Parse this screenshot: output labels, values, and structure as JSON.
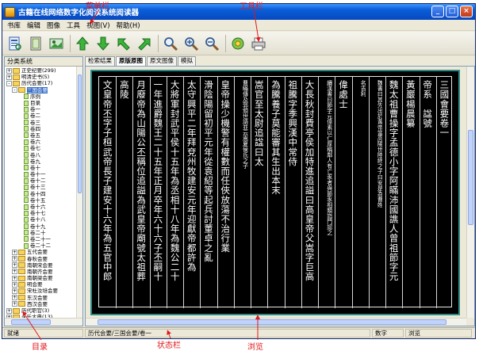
{
  "window": {
    "title": "古籍在线网络数字化阅读系统阅读器",
    "btn_min": "_",
    "btn_max": "□",
    "btn_close": "×"
  },
  "menu": [
    "书库",
    "编辑",
    "图像",
    "工具",
    "视图(V)",
    "帮助(H)"
  ],
  "toolbar": {
    "buttons": [
      "open-book-icon",
      "page-icon",
      "image-icon",
      "arrow-up-icon",
      "arrow-down-icon",
      "arrow-back-icon",
      "arrow-forward-icon",
      "search-icon",
      "zoom-in-icon",
      "zoom-out-icon",
      "globe-icon",
      "print-icon"
    ]
  },
  "left_panel": {
    "title": "分类系统",
    "tree": [
      {
        "label": "正史纪要(299)",
        "level": 0,
        "exp": "+",
        "type": "folder"
      },
      {
        "label": "明清史书(5)",
        "level": 0,
        "exp": "+",
        "type": "folder"
      },
      {
        "label": "历代会要(17)",
        "level": 0,
        "exp": "-",
        "type": "folder"
      },
      {
        "label": "三国会要",
        "level": 1,
        "exp": "-",
        "type": "folder",
        "selected": true
      },
      {
        "label": "序例",
        "level": 2,
        "type": "doc"
      },
      {
        "label": "目录",
        "level": 2,
        "type": "doc"
      },
      {
        "label": "卷一",
        "level": 2,
        "type": "doc"
      },
      {
        "label": "卷二",
        "level": 2,
        "type": "doc"
      },
      {
        "label": "卷三",
        "level": 2,
        "type": "doc"
      },
      {
        "label": "卷四",
        "level": 2,
        "type": "doc"
      },
      {
        "label": "卷五",
        "level": 2,
        "type": "doc"
      },
      {
        "label": "卷六",
        "level": 2,
        "type": "doc"
      },
      {
        "label": "卷七",
        "level": 2,
        "type": "doc"
      },
      {
        "label": "卷八",
        "level": 2,
        "type": "doc"
      },
      {
        "label": "卷九",
        "level": 2,
        "type": "doc"
      },
      {
        "label": "卷十",
        "level": 2,
        "type": "doc"
      },
      {
        "label": "卷十一",
        "level": 2,
        "type": "doc"
      },
      {
        "label": "卷十二",
        "level": 2,
        "type": "doc"
      },
      {
        "label": "卷十三",
        "level": 2,
        "type": "doc"
      },
      {
        "label": "卷十四",
        "level": 2,
        "type": "doc"
      },
      {
        "label": "卷十五",
        "level": 2,
        "type": "doc"
      },
      {
        "label": "卷十六",
        "level": 2,
        "type": "doc"
      },
      {
        "label": "卷十七",
        "level": 2,
        "type": "doc"
      },
      {
        "label": "卷十八",
        "level": 2,
        "type": "doc"
      },
      {
        "label": "卷十九",
        "level": 2,
        "type": "doc"
      },
      {
        "label": "卷二十",
        "level": 2,
        "type": "doc"
      },
      {
        "label": "卷二十一",
        "level": 2,
        "type": "doc"
      },
      {
        "label": "卷二十二",
        "level": 2,
        "type": "doc"
      },
      {
        "label": "五代会要",
        "level": 1,
        "exp": "+",
        "type": "folder"
      },
      {
        "label": "春秋会要",
        "level": 1,
        "exp": "+",
        "type": "folder"
      },
      {
        "label": "南朝宋会要",
        "level": 1,
        "exp": "+",
        "type": "folder"
      },
      {
        "label": "南朝齐会要",
        "level": 1,
        "exp": "+",
        "type": "folder"
      },
      {
        "label": "南朝梁会要",
        "level": 1,
        "exp": "+",
        "type": "folder"
      },
      {
        "label": "明会要",
        "level": 1,
        "exp": "+",
        "type": "folder"
      },
      {
        "label": "宋杜汝培会要",
        "level": 1,
        "exp": "+",
        "type": "folder"
      },
      {
        "label": "东汉会要",
        "level": 1,
        "exp": "+",
        "type": "folder"
      },
      {
        "label": "西汉会要",
        "level": 1,
        "exp": "+",
        "type": "folder"
      },
      {
        "label": "历代职官(3)",
        "level": 0,
        "exp": "+",
        "type": "folder"
      },
      {
        "label": "永乐大典(13)",
        "level": 0,
        "exp": "+",
        "type": "folder"
      },
      {
        "label": "书目",
        "level": 0,
        "exp": "+",
        "type": "folder"
      },
      {
        "label": "经史子集",
        "level": 0,
        "exp": "+",
        "type": "folder"
      },
      {
        "label": "四库存目",
        "level": 0,
        "exp": "+",
        "type": "folder"
      }
    ]
  },
  "tabs": [
    "检索结果",
    "原版原图",
    "原文图像",
    "模拟"
  ],
  "book": {
    "columns": [
      {
        "text": "三國會要卷一",
        "size": "big"
      },
      {
        "text": "帝系　諡號",
        "size": "big"
      },
      {
        "text": "黃巖楊晨纂",
        "size": "big"
      },
      {
        "text": "魏太祖曹操字孟德小字阿瞞沛國譙人曾祖節字元",
        "size": "big"
      },
      {
        "text": "魏書曰其先出於黃帝當高陽世陸終之子曰安是為曹姓",
        "size": "small"
      },
      {
        "text": "名吉利",
        "size": "small"
      },
      {
        "text": "偉處士",
        "size": "big"
      },
      {
        "text": "續漢書曰節字元偉素以仁厚稱鄰人有亡豕者與節豕相類詣門認之",
        "size": "small"
      },
      {
        "text": "大長秋封費亭侯加特進追謚曰高皇帝父嵩字巨高",
        "size": "big"
      },
      {
        "text": "祖騰字季興漢中常侍",
        "size": "big"
      },
      {
        "text": "為騰養子莫能審其生出本末",
        "size": "big"
      },
      {
        "text": "嵩官至太尉追諡曰太",
        "size": "big"
      },
      {
        "text": "曹瞞傳及郭頒世語並云嵩夏侯氏之子",
        "size": "small"
      },
      {
        "text": "皇帝操少機警有權數而任俠放蕩不治行業",
        "size": "big"
      },
      {
        "text": "滑陰陽留初平元年從袁紹等起兵討董卓之亂",
        "size": "big"
      },
      {
        "text": "太守興平二年拜兗州牧建安元年迎獻帝都許為",
        "size": "big"
      },
      {
        "text": "大將軍封武平侯十五年為丞相十八年為魏公二十",
        "size": "big"
      },
      {
        "text": "一年進爵魏王二十五年正月卒年六十六子丕嗣十",
        "size": "big"
      },
      {
        "text": "月廢帝為山陽公丕稱位追謚為武皇帝廟號太祖葬",
        "size": "big"
      },
      {
        "text": "高陵",
        "size": "big"
      },
      {
        "text": "文皇帝丕字子桓武帝長子建安十六年為五官中郎",
        "size": "big"
      }
    ]
  },
  "status": {
    "ready": "就绪",
    "path": "历代会要/三国会要/卷一",
    "indicator": "数字",
    "mode": "浏览"
  },
  "callouts": {
    "menubar": "菜单栏",
    "toolbar": "工具栏",
    "catalog": "目录",
    "statusbar": "状态栏",
    "browse": "浏览"
  }
}
